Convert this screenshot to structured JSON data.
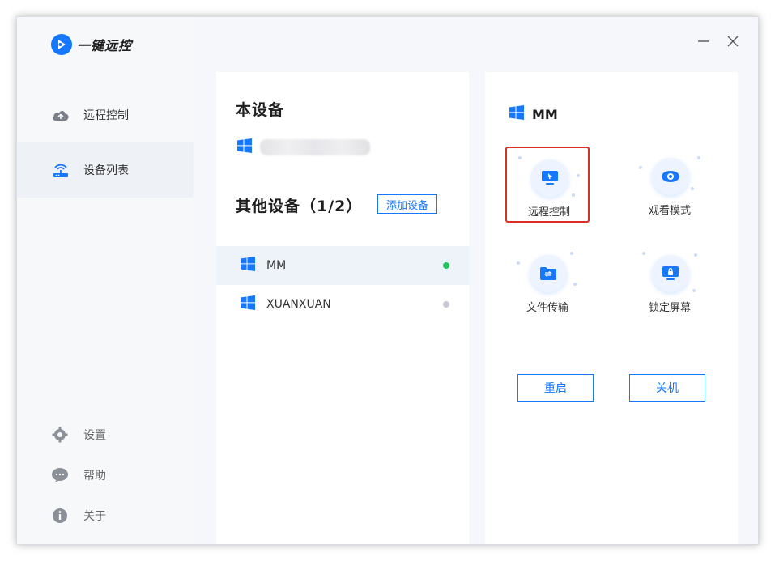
{
  "app": {
    "name": "一键远控",
    "accent": "#1677ff"
  },
  "window_controls": {
    "minimize_icon": "minimize-icon",
    "close_icon": "close-icon"
  },
  "sidebar": {
    "items": [
      {
        "label": "远程控制",
        "icon": "cloud-remote-icon",
        "active": false
      },
      {
        "label": "设备列表",
        "icon": "router-icon",
        "active": true
      }
    ],
    "footer": [
      {
        "label": "设置",
        "icon": "gear-icon"
      },
      {
        "label": "帮助",
        "icon": "chat-help-icon"
      },
      {
        "label": "关于",
        "icon": "info-icon"
      }
    ]
  },
  "device_panel": {
    "this_device_title": "本设备",
    "other_devices_title": "其他设备（1/2）",
    "add_device_label": "添加设备",
    "devices": [
      {
        "name": "MM",
        "status": "online",
        "status_color": "#22c55e",
        "selected": true
      },
      {
        "name": "XUANXUAN",
        "status": "offline",
        "status_color": "#c7cad1",
        "selected": false
      }
    ]
  },
  "detail_panel": {
    "device_name": "MM",
    "actions": [
      {
        "label": "远程控制",
        "icon": "monitor-cursor-icon",
        "highlighted": true
      },
      {
        "label": "观看模式",
        "icon": "eye-icon",
        "highlighted": false
      },
      {
        "label": "文件传输",
        "icon": "folder-transfer-icon",
        "highlighted": false
      },
      {
        "label": "锁定屏幕",
        "icon": "lock-screen-icon",
        "highlighted": false
      }
    ],
    "restart_label": "重启",
    "shutdown_label": "关机"
  }
}
